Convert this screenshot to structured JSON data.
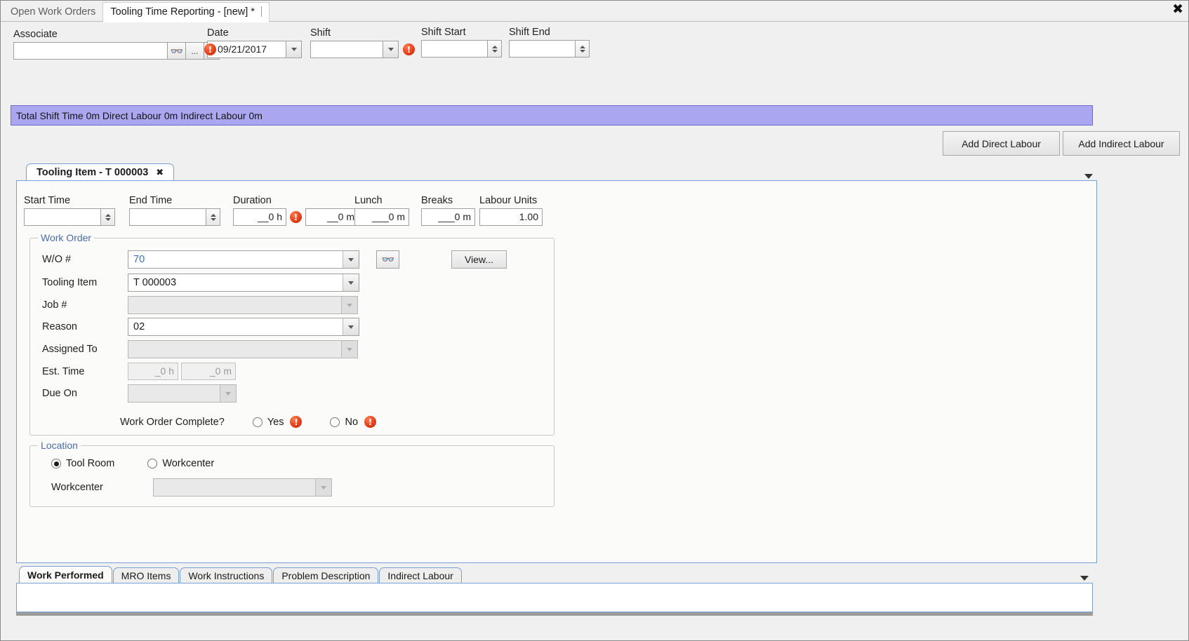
{
  "window": {
    "close_label": "✖"
  },
  "top_tabs": [
    {
      "label": "Open Work Orders",
      "active": false
    },
    {
      "label": "Tooling Time Reporting - [new] *",
      "active": true
    }
  ],
  "header": {
    "associate": {
      "label": "Associate",
      "value": "",
      "search_icon": "binoculars-icon",
      "ellipsis_label": "...",
      "dropdown_icon": "chevron-down-icon"
    },
    "date": {
      "label": "Date",
      "value": "09/21/2017",
      "has_error": true
    },
    "shift": {
      "label": "Shift",
      "value": "",
      "has_error": true
    },
    "shift_start": {
      "label": "Shift Start",
      "value": ""
    },
    "shift_end": {
      "label": "Shift End",
      "value": ""
    }
  },
  "summary": {
    "text": "Total Shift Time 0m  Direct Labour 0m  Indirect Labour 0m",
    "bar_color": "#aaa7f0"
  },
  "actions": {
    "add_direct_labour": "Add Direct Labour",
    "add_indirect_labour": "Add Indirect Labour"
  },
  "item_tab": {
    "label": "Tooling Item - T 000003",
    "close_glyph": "✖"
  },
  "time_fields": {
    "start_time": {
      "label": "Start Time",
      "value": ""
    },
    "end_time": {
      "label": "End Time",
      "value": ""
    },
    "duration": {
      "label": "Duration",
      "hours": "__0 h",
      "minutes": "__0 m",
      "has_error": true
    },
    "lunch": {
      "label": "Lunch",
      "value": "___0 m"
    },
    "breaks": {
      "label": "Breaks",
      "value": "___0 m"
    },
    "labour_units": {
      "label": "Labour Units",
      "value": "1.00"
    }
  },
  "work_order": {
    "group_label": "Work Order",
    "wo_number": {
      "label": "W/O #",
      "value": "70",
      "disabled": false
    },
    "tooling_item": {
      "label": "Tooling Item",
      "value": "T 000003",
      "disabled": false
    },
    "job_number": {
      "label": "Job #",
      "value": "",
      "disabled": true
    },
    "reason": {
      "label": "Reason",
      "value": "02",
      "disabled": false
    },
    "assigned_to": {
      "label": "Assigned To",
      "value": "",
      "disabled": true
    },
    "est_time": {
      "label": "Est. Time",
      "hours": "_0 h",
      "minutes": "_0 m",
      "disabled": true
    },
    "due_on": {
      "label": "Due On",
      "value": "",
      "disabled": true
    },
    "search_icon": "binoculars-icon",
    "view_button": "View...",
    "complete": {
      "label": "Work Order Complete?",
      "yes_label": "Yes",
      "no_label": "No",
      "selected": "",
      "has_error": true
    }
  },
  "location": {
    "group_label": "Location",
    "tool_room": {
      "label": "Tool Room",
      "selected": true
    },
    "workcenter_radio": {
      "label": "Workcenter",
      "selected": false
    },
    "workcenter_field": {
      "label": "Workcenter",
      "value": "",
      "disabled": true
    }
  },
  "bottom_tabs": [
    {
      "label": "Work Performed",
      "active": true
    },
    {
      "label": "MRO Items",
      "active": false
    },
    {
      "label": "Work Instructions",
      "active": false
    },
    {
      "label": "Problem Description",
      "active": false
    },
    {
      "label": "Indirect Labour",
      "active": false
    }
  ],
  "notes": {
    "value": ""
  }
}
